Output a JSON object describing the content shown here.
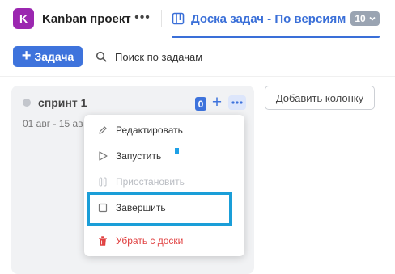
{
  "header": {
    "project_initial": "K",
    "project_name": "Kanban проект",
    "more_glyph": "•••",
    "board_tab_label": "Доска задач - По версиям",
    "board_tab_count": "10",
    "accent_color": "#3a6fd8",
    "avatar_color": "#9b27b0"
  },
  "toolbar": {
    "add_task_plus": "+",
    "add_task_label": "Задача",
    "search_label": "Поиск по задачам",
    "search_icon": "search-icon"
  },
  "column": {
    "title": "спринт 1",
    "dates": "01 авг - 15 ав",
    "task_count": "0",
    "add_glyph": "+",
    "more_icon": "more-horizontal-icon"
  },
  "add_column_label": "Добавить колонку",
  "menu": {
    "items": [
      {
        "label": "Редактировать",
        "icon": "pencil-icon",
        "disabled": false
      },
      {
        "label": "Запустить",
        "icon": "play-icon",
        "disabled": false
      },
      {
        "label": "Приостановить",
        "icon": "pause-icon",
        "disabled": true
      },
      {
        "label": "Завершить",
        "icon": "square-icon",
        "disabled": false
      },
      {
        "label": "Убрать с доски",
        "icon": "trash-icon",
        "disabled": false,
        "danger": true
      }
    ]
  },
  "colors": {
    "primary": "#3e73dc",
    "danger": "#e04040",
    "highlight": "#1a9ed8"
  }
}
